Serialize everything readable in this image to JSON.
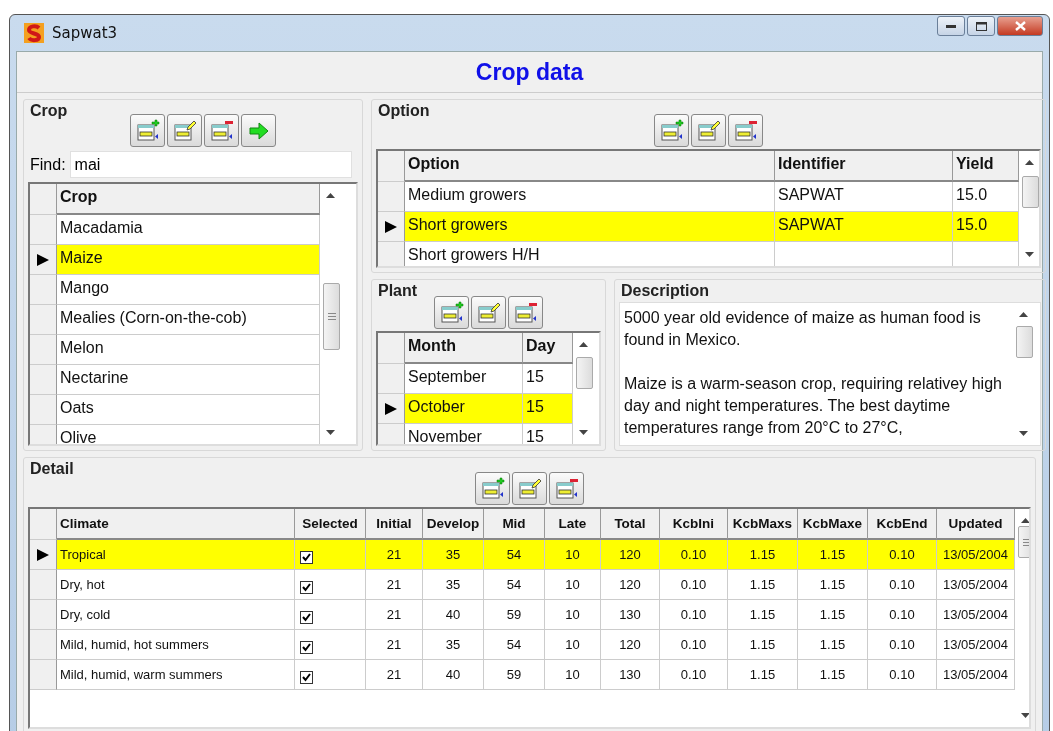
{
  "window": {
    "title": "Sapwat3"
  },
  "header": "Crop data",
  "crop": {
    "title": "Crop",
    "tools": [
      {
        "kind": "add"
      },
      {
        "kind": "edit"
      },
      {
        "kind": "delete"
      },
      {
        "kind": "go"
      }
    ],
    "find": {
      "label": "Find:",
      "value": "mai"
    },
    "table": {
      "columns": [
        "Crop"
      ],
      "rows": [
        {
          "cells": [
            "Macadamia"
          ],
          "selected": false
        },
        {
          "cells": [
            "Maize"
          ],
          "selected": true
        },
        {
          "cells": [
            "Mango"
          ],
          "selected": false
        },
        {
          "cells": [
            "Mealies (Corn-on-the-cob)"
          ],
          "selected": false
        },
        {
          "cells": [
            "Melon"
          ],
          "selected": false
        },
        {
          "cells": [
            "Nectarine"
          ],
          "selected": false
        },
        {
          "cells": [
            "Oats"
          ],
          "selected": false
        },
        {
          "cells": [
            "Olive"
          ],
          "selected": false
        }
      ]
    }
  },
  "option": {
    "title": "Option",
    "tools": [
      {
        "kind": "add"
      },
      {
        "kind": "edit"
      },
      {
        "kind": "delete"
      }
    ],
    "table": {
      "columns": [
        "Option",
        "Identifier",
        "Yield"
      ],
      "rows": [
        {
          "cells": [
            "Medium growers",
            "SAPWAT",
            "15.0"
          ],
          "selected": false
        },
        {
          "cells": [
            "Short growers",
            "SAPWAT",
            "15.0"
          ],
          "selected": true
        },
        {
          "cells": [
            "Short growers H/H"
          ],
          "selected": false
        }
      ]
    }
  },
  "plant": {
    "title": "Plant",
    "tools": [
      {
        "kind": "add"
      },
      {
        "kind": "edit"
      },
      {
        "kind": "delete"
      }
    ],
    "table": {
      "columns": [
        "Month",
        "Day"
      ],
      "rows": [
        {
          "cells": [
            "September",
            "15"
          ],
          "selected": false
        },
        {
          "cells": [
            "October",
            "15"
          ],
          "selected": true
        },
        {
          "cells": [
            "November",
            "15"
          ],
          "selected": false
        }
      ]
    }
  },
  "description": {
    "title": "Description",
    "paragraphs": [
      "5000 year old evidence of maize as human food is found in Mexico.",
      "Maize is a warm-season crop, requiring relativey high day and night temperatures.  The best daytime temperatures range from 20°C to 27°C,"
    ]
  },
  "detail": {
    "title": "Detail",
    "tools": [
      {
        "kind": "add"
      },
      {
        "kind": "edit"
      },
      {
        "kind": "delete"
      }
    ],
    "table": {
      "columns": [
        "Climate",
        "Selected",
        "Initial",
        "Develop",
        "Mid",
        "Late",
        "Total",
        "KcbIni",
        "KcbMaxs",
        "KcbMaxe",
        "KcbEnd",
        "Updated"
      ],
      "rows": [
        {
          "climate": "Tropical",
          "checked": true,
          "values": [
            "21",
            "35",
            "54",
            "10",
            "120",
            "0.10",
            "1.15",
            "1.15",
            "0.10",
            "13/05/2004"
          ],
          "selected": true
        },
        {
          "climate": "Dry, hot",
          "checked": true,
          "values": [
            "21",
            "35",
            "54",
            "10",
            "120",
            "0.10",
            "1.15",
            "1.15",
            "0.10",
            "13/05/2004"
          ],
          "selected": false
        },
        {
          "climate": "Dry, cold",
          "checked": true,
          "values": [
            "21",
            "40",
            "59",
            "10",
            "130",
            "0.10",
            "1.15",
            "1.15",
            "0.10",
            "13/05/2004"
          ],
          "selected": false
        },
        {
          "climate": "Mild, humid, hot summers",
          "checked": true,
          "values": [
            "21",
            "35",
            "54",
            "10",
            "120",
            "0.10",
            "1.15",
            "1.15",
            "0.10",
            "13/05/2004"
          ],
          "selected": false
        },
        {
          "climate": "Mild, humid, warm summers",
          "checked": true,
          "values": [
            "21",
            "40",
            "59",
            "10",
            "130",
            "0.10",
            "1.15",
            "1.15",
            "0.10",
            "13/05/2004"
          ],
          "selected": false
        }
      ]
    }
  }
}
